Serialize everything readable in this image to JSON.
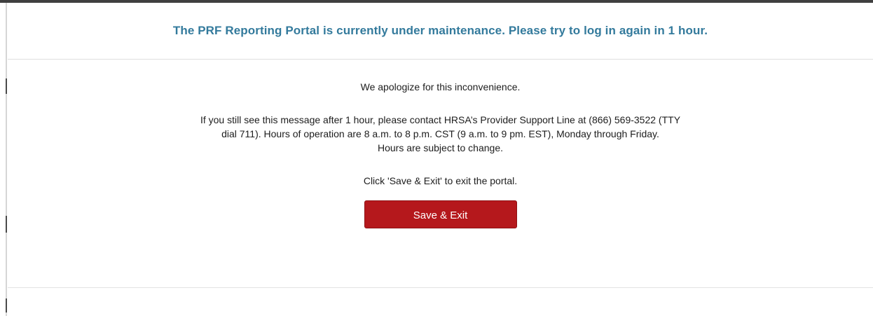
{
  "dialog": {
    "title": "The PRF Reporting Portal is currently under maintenance. Please try to log in again in 1 hour.",
    "apology": "We apologize for this inconvenience.",
    "support_lines": [
      "If you still see this message after 1 hour, please contact HRSA’s Provider Support Line at (866) 569-3522 (TTY",
      "dial 711). Hours of operation are 8 a.m. to 8 p.m. CST (9 a.m. to 9 pm. EST), Monday through Friday.",
      "Hours are subject to change."
    ],
    "exit_instruction": "Click 'Save & Exit' to exit the portal.",
    "save_exit_label": "Save & Exit"
  },
  "colors": {
    "title": "#337a9c",
    "button": "#b5181c",
    "text": "#1d1d1d"
  }
}
